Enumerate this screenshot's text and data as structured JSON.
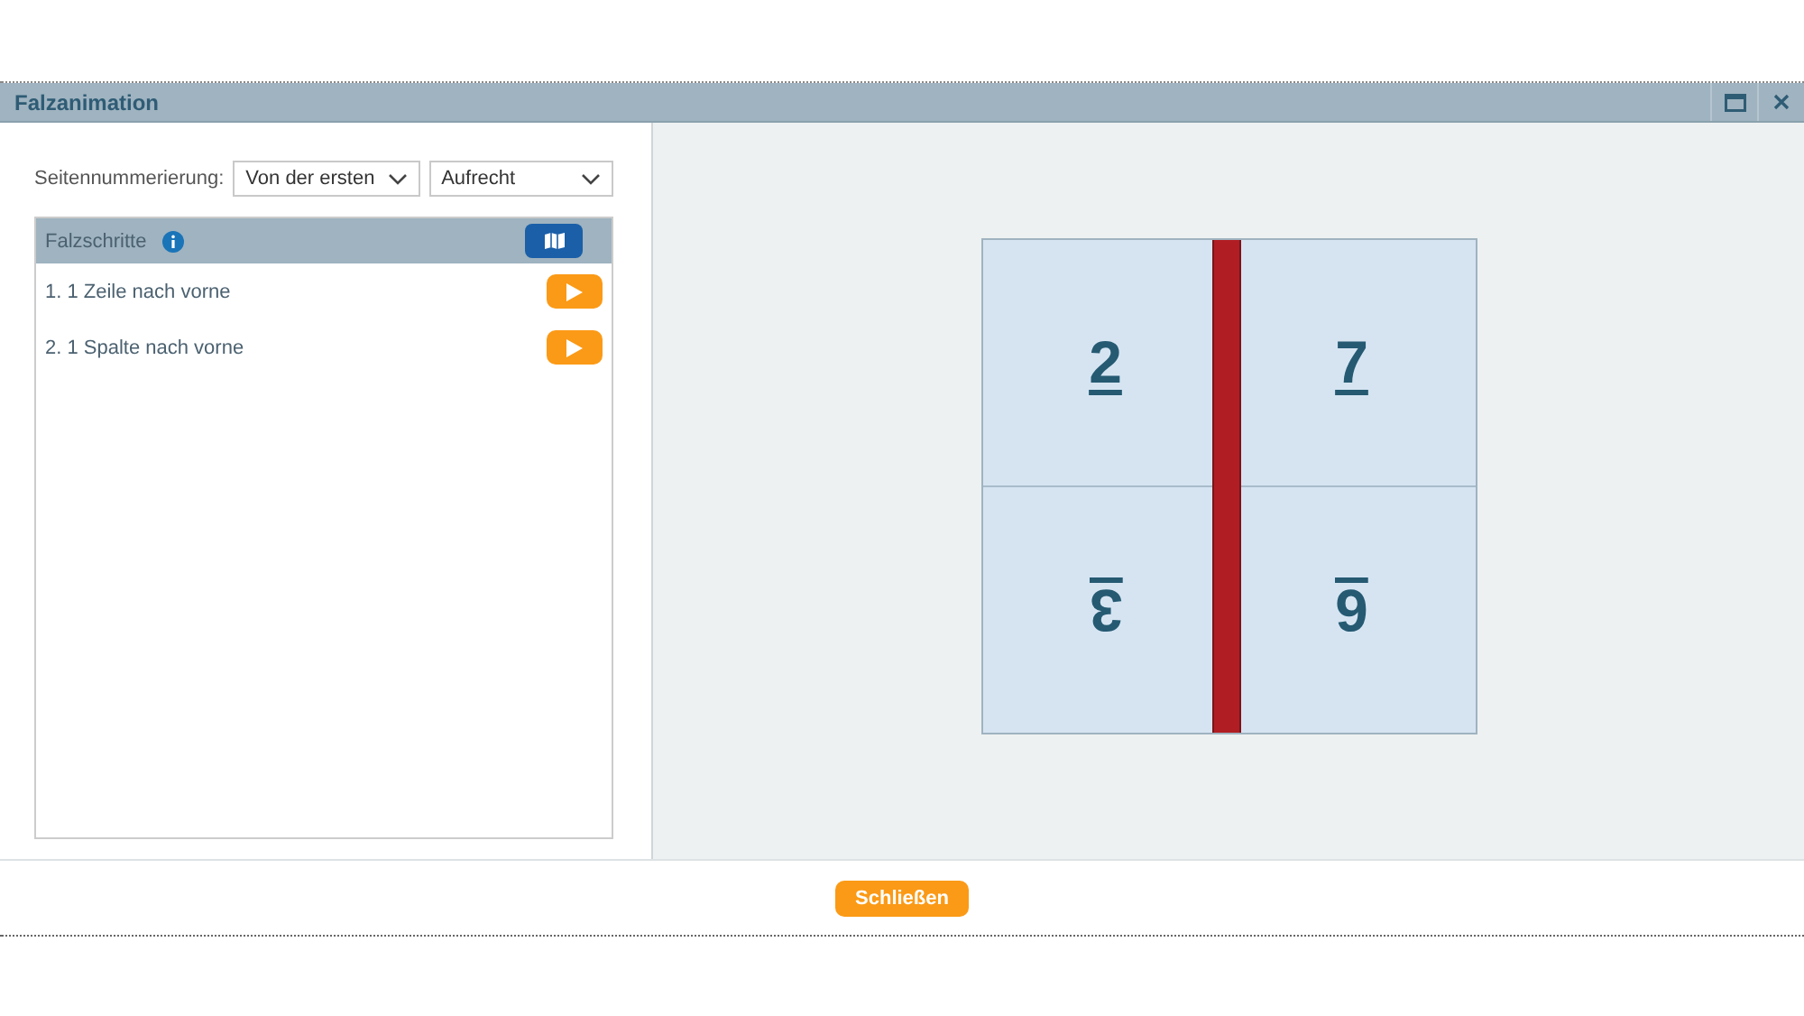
{
  "window": {
    "title": "Falzanimation"
  },
  "numbering": {
    "label": "Seitennummerierung:",
    "order": "Von der ersten",
    "orientation": "Aufrecht"
  },
  "steps_panel": {
    "title": "Falzschritte",
    "steps": [
      {
        "label": "1. 1 Zeile nach vorne"
      },
      {
        "label": "2. 1 Spalte nach vorne"
      }
    ]
  },
  "sheet": {
    "pages": [
      {
        "number": "2",
        "rotated": false
      },
      {
        "number": "7",
        "rotated": false
      },
      {
        "number": "3",
        "rotated": true
      },
      {
        "number": "6",
        "rotated": true
      }
    ]
  },
  "footer": {
    "close_button": "Schließen"
  }
}
